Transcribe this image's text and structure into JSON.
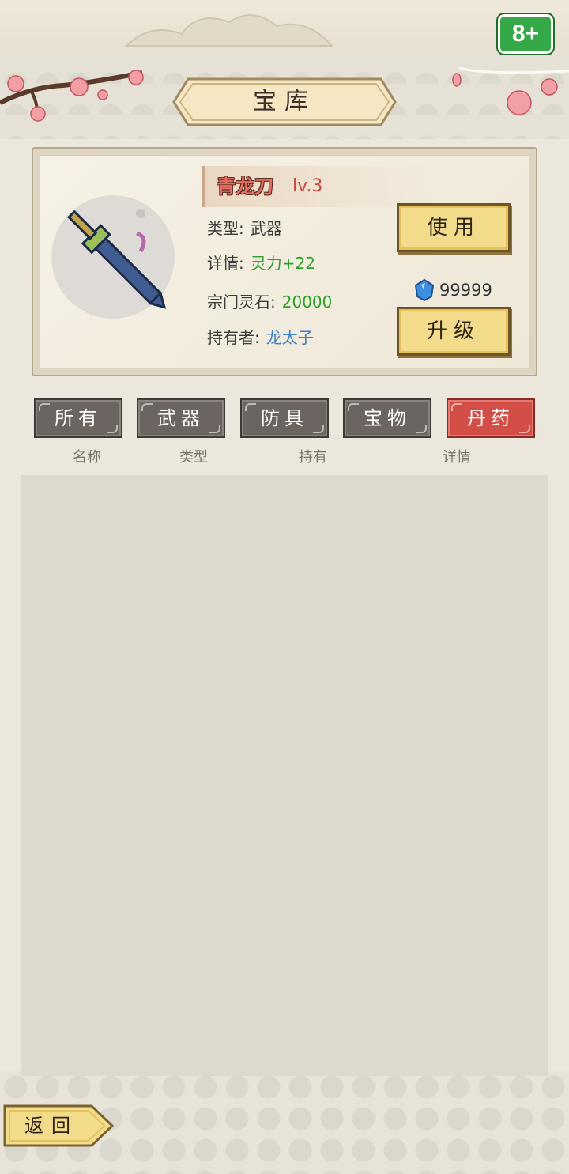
{
  "age_rating": "8+",
  "title": "宝库",
  "item": {
    "name": "青龙刀",
    "level": "lv.3",
    "type_label": "类型:",
    "type_value": "武器",
    "detail_label": "详情:",
    "detail_value": "灵力+22",
    "stone_label": "宗门灵石:",
    "stone_value": "20000",
    "owner_label": "持有者:",
    "owner_value": "龙太子"
  },
  "buttons": {
    "use": "使用",
    "upgrade": "升级",
    "back": "返回"
  },
  "currency": {
    "icon": "blue-gem-icon",
    "amount": "99999"
  },
  "tabs": [
    {
      "label": "所有",
      "active": false
    },
    {
      "label": "武器",
      "active": false
    },
    {
      "label": "防具",
      "active": false
    },
    {
      "label": "宝物",
      "active": false
    },
    {
      "label": "丹药",
      "active": true
    }
  ],
  "columns": [
    "名称",
    "类型",
    "持有",
    "详情"
  ],
  "colors": {
    "active_tab": "#d34e47",
    "inactive_tab": "#6b6461",
    "gold_button": "#f2dc8c",
    "name_red": "#c9473f",
    "value_green": "#2aa02a",
    "owner_blue": "#3a7fc8"
  }
}
